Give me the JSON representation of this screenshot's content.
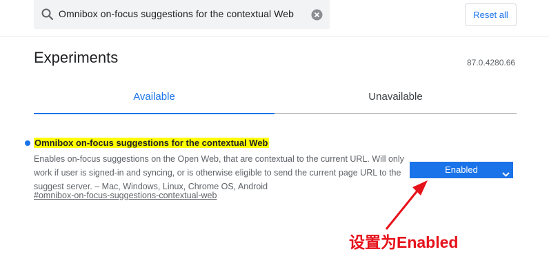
{
  "search": {
    "query": "Omnibox on-focus suggestions for the contextual Web"
  },
  "header": {
    "reset_label": "Reset all"
  },
  "page": {
    "title": "Experiments",
    "version": "87.0.4280.66"
  },
  "tabs": [
    {
      "label": "Available",
      "active": true
    },
    {
      "label": "Unavailable",
      "active": false
    }
  ],
  "flag": {
    "title": "Omnibox on-focus suggestions for the contextual Web",
    "description": "Enables on-focus suggestions on the Open Web, that are contextual to the current URL. Will only work if user is signed-in and syncing, or is otherwise eligible to send the current page URL to the suggest server. – Mac, Windows, Linux, Chrome OS, Android",
    "anchor": "#omnibox-on-focus-suggestions-contextual-web",
    "selected": "Enabled"
  },
  "annotation": {
    "text": "设置为Enabled"
  },
  "colors": {
    "accent": "#1a73e8",
    "highlight": "#ffff00",
    "annotation": "#e6121b"
  }
}
